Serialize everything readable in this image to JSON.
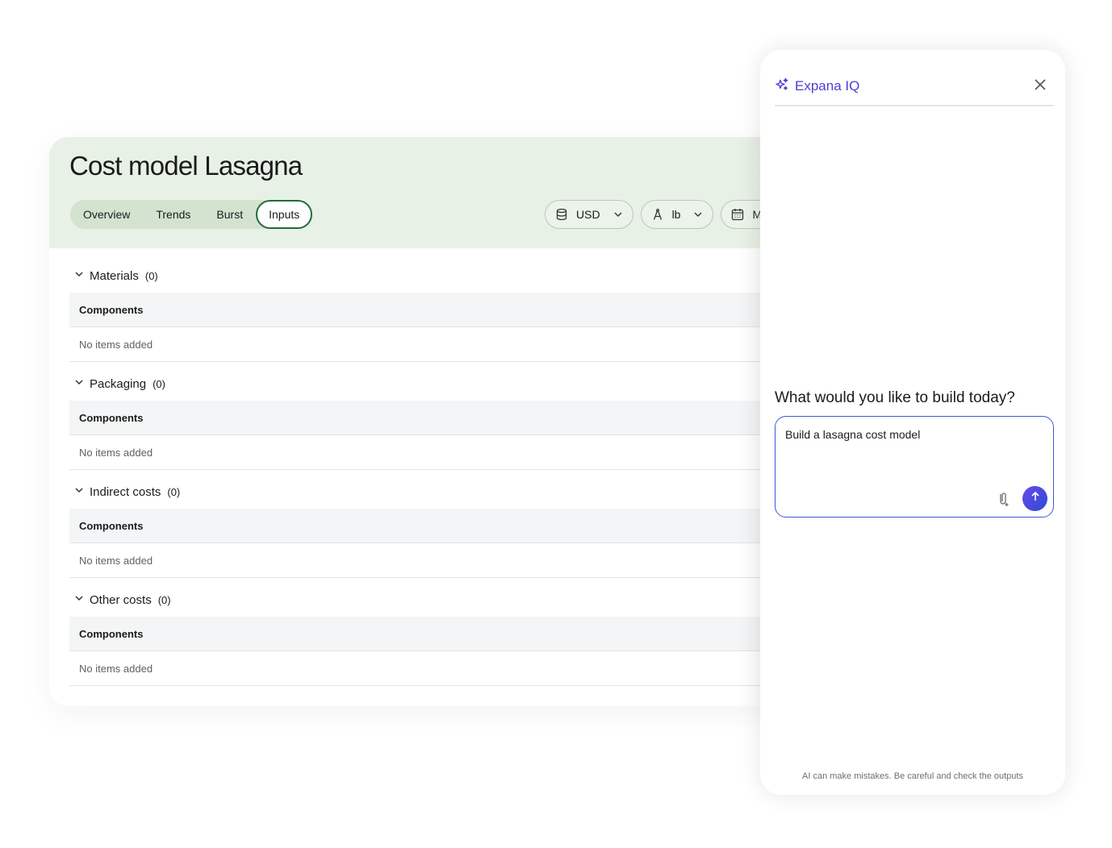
{
  "page": {
    "title": "Cost model Lasagna"
  },
  "tabs": [
    {
      "label": "Overview",
      "active": false
    },
    {
      "label": "Trends",
      "active": false
    },
    {
      "label": "Burst",
      "active": false
    },
    {
      "label": "Inputs",
      "active": true
    }
  ],
  "controls": {
    "currency": {
      "value": "USD",
      "icon": "database-icon"
    },
    "unit": {
      "value": "lb",
      "icon": "compass-icon"
    },
    "period": {
      "value": "Mo",
      "icon": "calendar-icon"
    }
  },
  "sections": [
    {
      "title": "Materials",
      "count": "(0)",
      "column_header": "Components",
      "empty_text": "No items added"
    },
    {
      "title": "Packaging",
      "count": "(0)",
      "column_header": "Components",
      "empty_text": "No items added"
    },
    {
      "title": "Indirect costs",
      "count": "(0)",
      "column_header": "Components",
      "empty_text": "No items added"
    },
    {
      "title": "Other costs",
      "count": "(0)",
      "column_header": "Components",
      "empty_text": "No items added"
    }
  ],
  "assistant": {
    "brand_name": "Expana IQ",
    "brand_color": "#4a3fd9",
    "prompt_question": "What would you like to build today?",
    "prompt_value": "Build a lasagna cost model",
    "disclaimer": "AI can make mistakes. Be careful and check the outputs"
  },
  "colors": {
    "header_bg": "#e8f1e6",
    "active_tab_border": "#226c3a",
    "send_button": "#4b47e0"
  }
}
